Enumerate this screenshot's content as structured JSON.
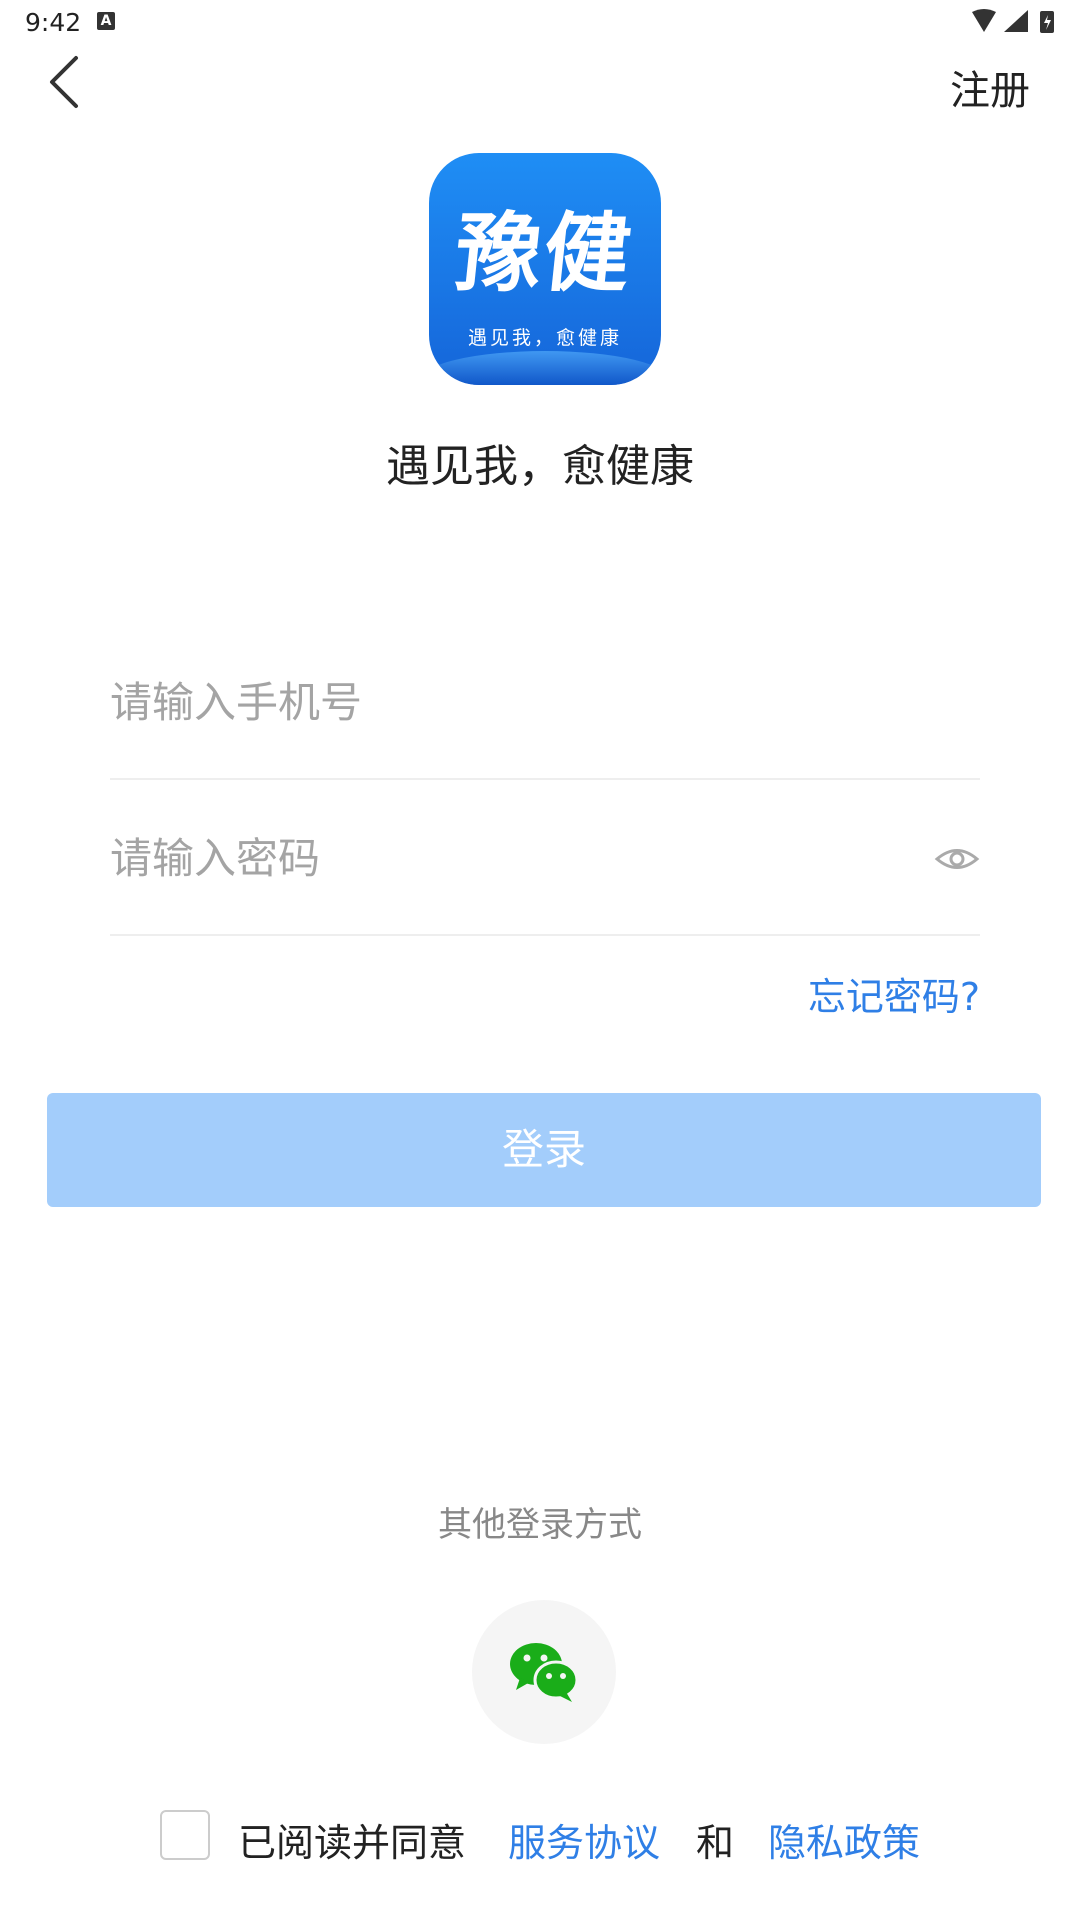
{
  "status_bar": {
    "time": "9:42",
    "notification_badge": "A"
  },
  "header": {
    "register_label": "注册"
  },
  "logo": {
    "main_text": "豫健",
    "sub_text": "遇见我，愈健康"
  },
  "slogan": "遇见我，愈健康",
  "form": {
    "phone_placeholder": "请输入手机号",
    "password_placeholder": "请输入密码",
    "forgot_label": "忘记密码?"
  },
  "login_button": "登录",
  "other_login": {
    "title": "其他登录方式"
  },
  "agreement": {
    "prefix": "已阅读并同意",
    "service_link": "服务协议",
    "and": "和",
    "privacy_link": "隐私政策"
  },
  "colors": {
    "link_blue": "#2f7fe6",
    "login_button_bg": "#a3cdfb",
    "logo_blue": "#1f8ef5",
    "wechat_green": "#1aad19"
  }
}
